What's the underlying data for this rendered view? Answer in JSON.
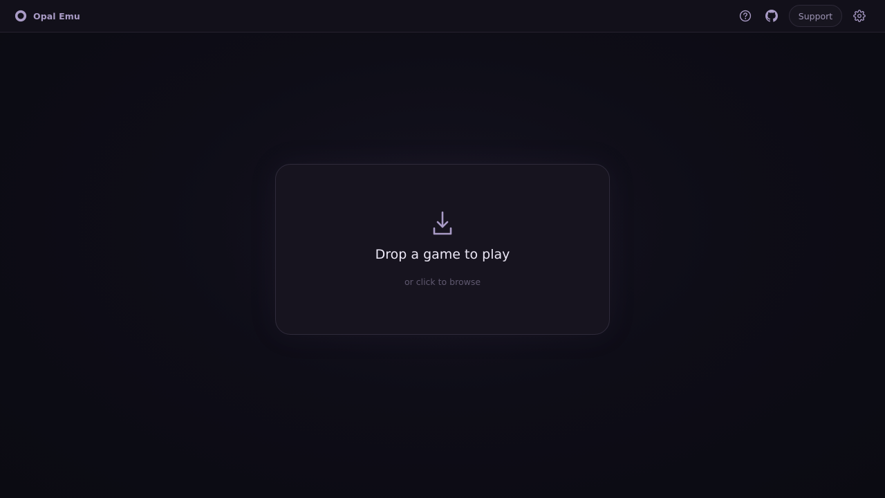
{
  "app": {
    "name": "Opal Emu",
    "accent_color": "#a99bc6"
  },
  "header": {
    "help_icon": "help-circle-icon",
    "github_icon": "github-icon",
    "support_label": "Support",
    "settings_icon": "gear-icon"
  },
  "dropzone": {
    "icon": "download-icon",
    "title": "Drop a game to play",
    "subtitle": "or click to browse"
  },
  "colors": {
    "background": "#0e0d17",
    "card": "#17141f",
    "text_primary": "#ece8f6",
    "text_muted": "#5f586f"
  }
}
